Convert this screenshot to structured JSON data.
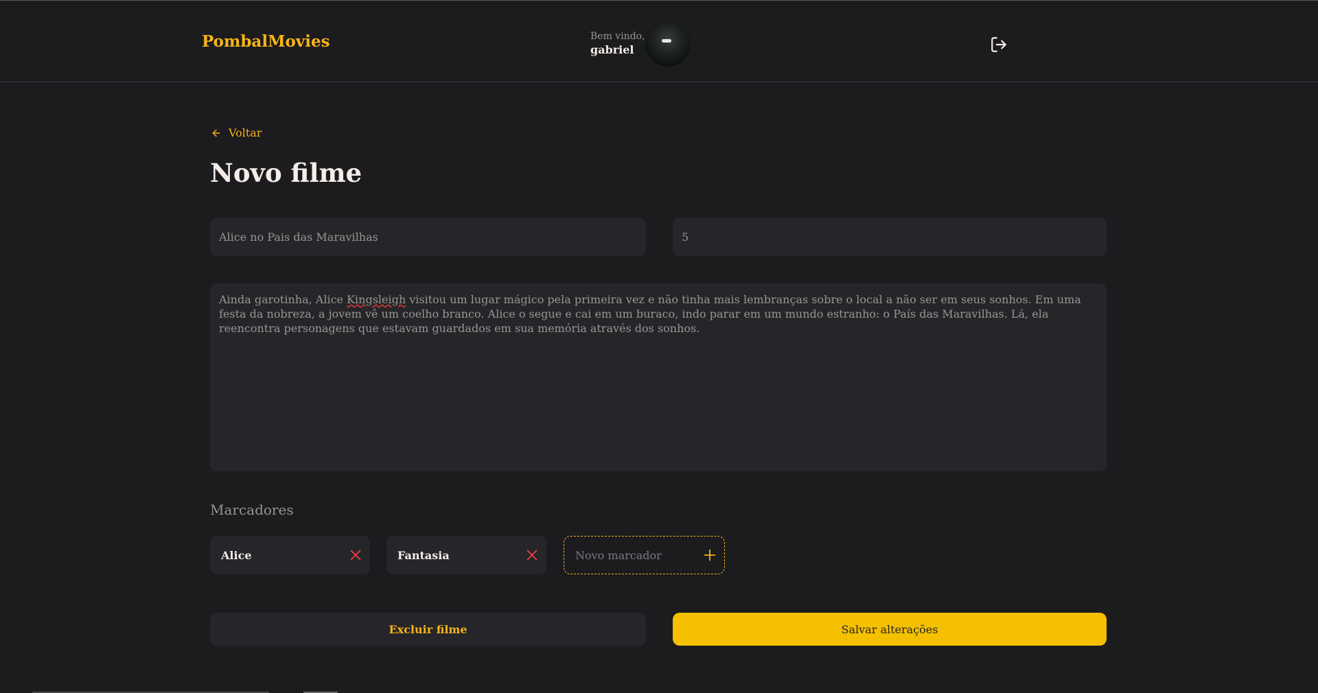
{
  "header": {
    "brand": "PombalMovies",
    "welcome": "Bem vindo,",
    "username": "gabriel"
  },
  "nav": {
    "back_label": "Voltar"
  },
  "page": {
    "title": "Novo filme"
  },
  "form": {
    "title_value": "Alice no Pais das Maravilhas",
    "rating_value": "5",
    "description_before": "Ainda garotinha, Alice ",
    "description_misspelled": "Kingsleigh",
    "description_after": " visitou um lugar mágico pela primeira vez e não tinha mais lembranças sobre o local a não ser em seus sonhos. Em uma festa da nobreza, a jovem vê um coelho branco. Alice o segue e cai em um buraco, indo parar em um mundo estranho: o País das Maravilhas. Lá, ela reencontra personagens que estavam guardados em sua memória através dos sonhos."
  },
  "tags": {
    "section_title": "Marcadores",
    "items": [
      {
        "label": "Alice"
      },
      {
        "label": "Fantasia"
      }
    ],
    "new_placeholder": "Novo marcador"
  },
  "actions": {
    "delete_label": "Excluir filme",
    "save_label": "Salvar alterações"
  },
  "colors": {
    "accent": "#f5b417",
    "save_button": "#f5c000",
    "background": "#1c1b1e",
    "field_background": "#262529",
    "remove_icon": "#e83f3f"
  },
  "icons": {
    "back": "arrow-left-icon",
    "logout": "logout-icon",
    "remove": "x-icon",
    "add": "plus-icon"
  }
}
